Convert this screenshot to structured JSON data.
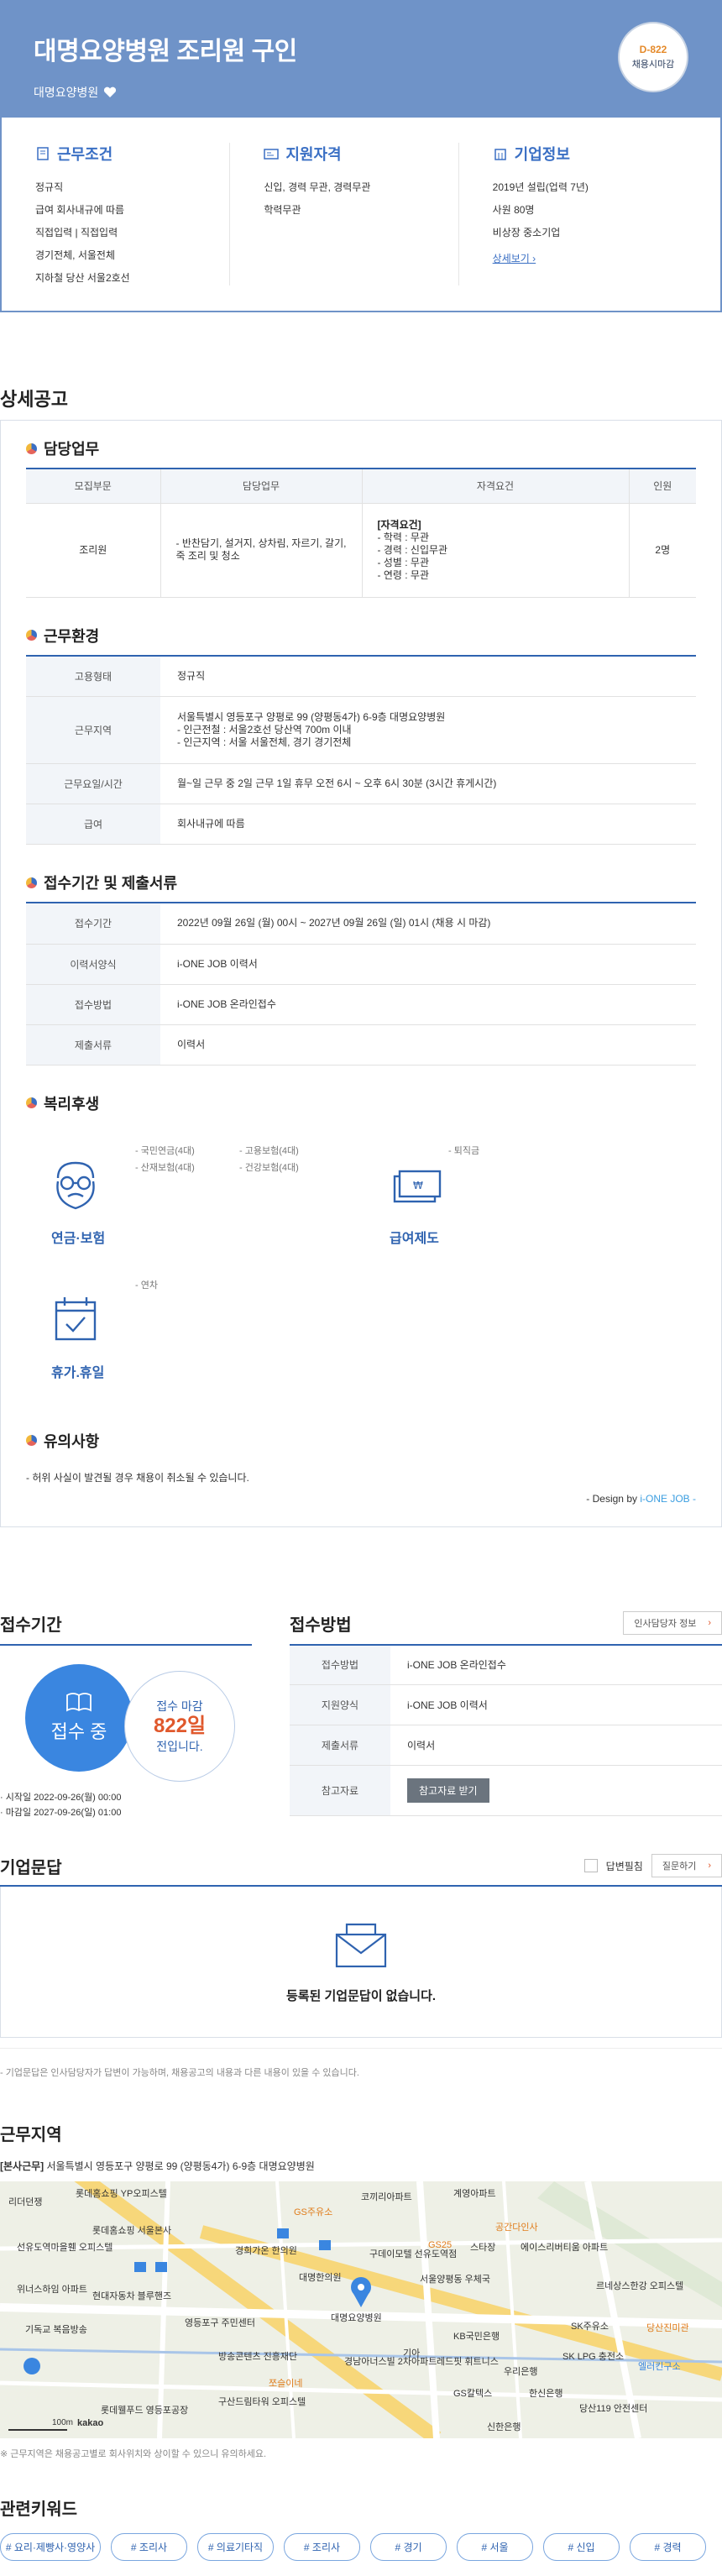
{
  "header": {
    "title": "대명요양병원 조리원 구인",
    "company": "대명요양병원",
    "dday": "D-822",
    "dday_status": "채용시마감"
  },
  "summary": {
    "conditions": {
      "title": "근무조건",
      "items": [
        "정규직",
        "급여 회사내규에 따름",
        "직접입력 | 직접입력",
        "경기전체, 서울전체",
        "지하철 당산 서울2호선"
      ]
    },
    "qualifications": {
      "title": "지원자격",
      "items": [
        "신입, 경력 무관, 경력무관",
        "학력무관"
      ]
    },
    "company_info": {
      "title": "기업정보",
      "items": [
        "2019년 설립(업력 7년)",
        "사원 80명",
        "비상장 중소기업"
      ],
      "more": "상세보기"
    }
  },
  "detail": {
    "title": "상세공고",
    "duty": {
      "title": "담당업무",
      "headers": [
        "모집부문",
        "담당업무",
        "자격요건",
        "인원"
      ],
      "row": {
        "dept": "조리원",
        "tasks": [
          "- 반찬담기, 설거지, 상차림, 자르기, 갈기,",
          "죽 조리 및 청소"
        ],
        "req_title": "[자격요건]",
        "reqs": [
          "- 학력 : 무관",
          "- 경력 : 신입무관",
          "- 성별 : 무관",
          "- 연령 : 무관"
        ],
        "count": "2명"
      }
    },
    "env": {
      "title": "근무환경",
      "rows": [
        {
          "k": "고용형태",
          "v": [
            "정규직"
          ]
        },
        {
          "k": "근무지역",
          "v": [
            "서울특별시 영등포구 양평로 99 (양평동4가) 6-9층 대명요양병원",
            "- 인근전철 : 서울2호선 당산역 700m 이내",
            "- 인근지역 : 서울 서울전체, 경기 경기전체"
          ]
        },
        {
          "k": "근무요일/시간",
          "v": [
            "월~일 근무 중 2일 근무 1일 휴무 오전 6시 ~ 오후 6시 30분 (3시간 휴게시간)"
          ]
        },
        {
          "k": "급여",
          "v": [
            "회사내규에 따름"
          ]
        }
      ]
    },
    "period": {
      "title": "접수기간 및 제출서류",
      "rows": [
        {
          "k": "접수기간",
          "v": "2022년 09월 26일 (월) 00시 ~ 2027년 09월 26일 (일) 01시 (채용 시 마감)"
        },
        {
          "k": "이력서양식",
          "v": "i-ONE JOB 이력서"
        },
        {
          "k": "접수방법",
          "v": "i-ONE JOB 온라인접수"
        },
        {
          "k": "제출서류",
          "v": "이력서"
        }
      ]
    },
    "welfare": {
      "title": "복리후생",
      "pension": {
        "name": "연금·보험",
        "items": [
          "- 국민연금(4대)",
          "- 고용보험(4대)",
          "- 산재보험(4대)",
          "- 건강보험(4대)"
        ]
      },
      "salary": {
        "name": "급여제도",
        "items": [
          "- 퇴직금"
        ]
      },
      "vacation": {
        "name": "휴가.휴일",
        "items": [
          "- 연차"
        ]
      }
    },
    "caution": {
      "title": "유의사항",
      "text": "- 허위 사실이 발견될 경우 채용이 취소될 수 있습니다."
    },
    "design_prefix": "- Design by ",
    "design_brand": "i-ONE JOB -"
  },
  "apply": {
    "period_title": "접수기간",
    "status": "접수 중",
    "remain_label": "접수 마감",
    "remain_days": "822일",
    "remain_suffix": "전입니다.",
    "start": "· 시작일 2022-09-26(월) 00:00",
    "end": "· 마감일 2027-09-26(일) 01:00",
    "method_title": "접수방법",
    "manager_btn": "인사담당자 정보",
    "method_rows": [
      {
        "k": "접수방법",
        "v": "i-ONE JOB 온라인접수"
      },
      {
        "k": "지원양식",
        "v": "i-ONE JOB 이력서"
      },
      {
        "k": "제출서류",
        "v": "이력서"
      },
      {
        "k": "참고자료",
        "btn": "참고자료 받기"
      }
    ]
  },
  "qa": {
    "title": "기업문답",
    "answer_label": "답변필침",
    "ask_btn": "질문하기",
    "empty": "등록된 기업문답이 없습니다.",
    "note": "- 기업문답은 인사담당자가 답변이 가능하며, 채용공고의 내용과 다른 내용이 있을 수 있습니다."
  },
  "location": {
    "title": "근무지역",
    "addr_tag": "[본사근무]",
    "addr": " 서울특별시 영등포구 양평로 99 (양평동4가) 6-9층 대명요양병원",
    "map_labels": [
      "리더던쟁",
      "롯데홈쇼핑 YP오피스텔",
      "코끼리아파트",
      "계영아파트",
      "공간다인사",
      "선유도역마을휀 오피스텔",
      "롯데홈쇼핑 서울본사",
      "GS주유소",
      "GS25",
      "스타장",
      "에이스리버티움 아파트",
      "위너스하임 아파트",
      "현대자동차 블루핸즈",
      "경희가온 한의원",
      "구데이모텔 선유도역점",
      "서울양평동 우체국",
      "르네상스한강 오피스텔",
      "기독교 복음방송",
      "영등포구 주민센터",
      "대명한의원",
      "대명요양병원",
      "KB국민은행",
      "SK주유소",
      "당산진미관",
      "방송콘텐츠 진흥재단",
      "쪼슬이네",
      "경남아너스빌 2차아파트",
      "레드핏 휘트니스",
      "우리은행",
      "SK LPG 충전소",
      "엘러킨구소",
      "구산드림타워 오피스텔",
      "롯데웰푸드 영등포공장",
      "GS칼텍스",
      "한신은행",
      "당산119 안전센터",
      "신한은행",
      "기아",
      "100m",
      "kakao"
    ],
    "note": "※ 근무지역은 채용공고별로 회사위치와 상이할 수 있으니 유의하세요."
  },
  "keywords": {
    "title": "관련키워드",
    "items": [
      "# 요리·제빵사·영양사",
      "# 조리사",
      "# 의료기타직",
      "# 조리사",
      "# 경기",
      "# 서울",
      "# 신입",
      "# 경력"
    ]
  },
  "colors": {
    "hero": "#6f93c8",
    "accent": "#2f63b0",
    "orange": "#e0582c"
  }
}
